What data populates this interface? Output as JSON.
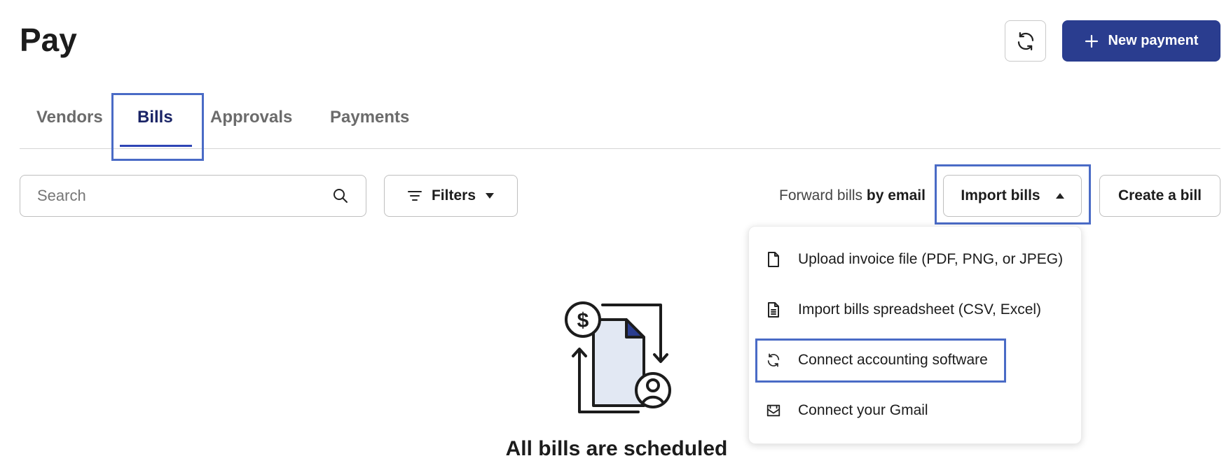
{
  "header": {
    "title": "Pay",
    "new_payment_label": "New payment"
  },
  "tabs": [
    {
      "label": "Vendors",
      "active": false
    },
    {
      "label": "Bills",
      "active": true
    },
    {
      "label": "Approvals",
      "active": false
    },
    {
      "label": "Payments",
      "active": false
    }
  ],
  "toolbar": {
    "search_placeholder": "Search",
    "filters_label": "Filters",
    "forward_prefix": "Forward bills",
    "forward_suffix": "by email",
    "import_label": "Import bills",
    "create_label": "Create a bill"
  },
  "import_menu": {
    "items": [
      {
        "label": "Upload invoice file (PDF, PNG, or JPEG)",
        "icon": "file-icon"
      },
      {
        "label": "Import bills spreadsheet (CSV, Excel)",
        "icon": "spreadsheet-file-icon"
      },
      {
        "label": "Connect accounting software",
        "icon": "sync-icon"
      },
      {
        "label": "Connect your Gmail",
        "icon": "mail-icon"
      }
    ]
  },
  "empty_state": {
    "title": "All bills are scheduled"
  },
  "colors": {
    "accent": "#2a3d8f",
    "active_tab": "#1a2466",
    "highlight_box": "#4a6bc6"
  }
}
